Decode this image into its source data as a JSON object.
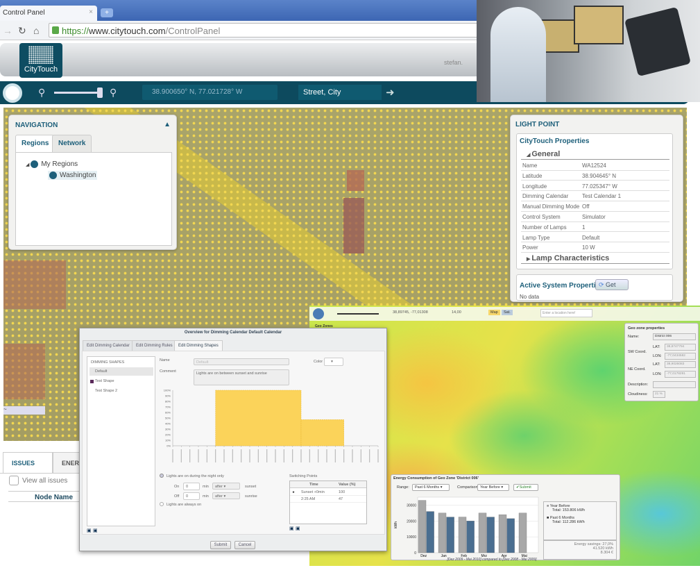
{
  "browser": {
    "tab_title": "Control Panel",
    "tab_close": "×",
    "new_tab": "+",
    "url_scheme": "https://",
    "url_host": "www.citytouch.com",
    "url_path": "/ControlPanel"
  },
  "header": {
    "logo_text": "CityTouch",
    "user": "stefan."
  },
  "toolbar": {
    "coordinates": "38.900650° N,  77.021728° W",
    "location": "Street, City"
  },
  "navigation": {
    "title": "NAVIGATION",
    "tabs": [
      "Regions",
      "Network"
    ],
    "tree": {
      "root": "My Regions",
      "child": "Washington"
    }
  },
  "light_point": {
    "title": "LIGHT POINT",
    "section": "CityTouch Properties",
    "group": "General",
    "properties": [
      [
        "Name",
        "WA12524"
      ],
      [
        "Latitude",
        "38.904645° N"
      ],
      [
        "Longitude",
        "77.025347° W"
      ],
      [
        "Dimming Calendar",
        "Test Calendar 1"
      ],
      [
        "Manual Dimming Mode",
        "Off"
      ],
      [
        "Control System",
        "Simulator"
      ],
      [
        "Number of Lamps",
        "1"
      ],
      [
        "Lamp Type",
        "Default"
      ],
      [
        "Power",
        "10 W"
      ]
    ],
    "lamp_characteristics": "Lamp Characteristics",
    "active_title": "Active System Properties",
    "get_button": "Get",
    "no_data": "No data"
  },
  "issues": {
    "tabs": [
      "ISSUES",
      "ENER"
    ],
    "view_all": "View all issues",
    "column": "Node Name"
  },
  "dimming_dialog": {
    "title": "Overview for Dimming Calendar Default Calendar",
    "tabs": [
      "Edit Dimming Calendar",
      "Edit Dimming Rules",
      "Edit Dimming Shapes"
    ],
    "shapes_header": "DIMMING SHAPES",
    "shapes": [
      "Default",
      "Test Shape",
      "Test Shape 2"
    ],
    "name_label": "Name",
    "name_value": "Default",
    "color_label": "Color",
    "comment_label": "Comment",
    "comment_value": "Lights are on between sunset and sunrise",
    "radio_night": "Lights are on during the night only",
    "radio_always": "Lights are always on",
    "on_label": "On",
    "off_label": "Off",
    "min": "min",
    "on_value": "0",
    "off_value": "0",
    "after": "after",
    "sunset": "sunset",
    "sunrise": "sunrise",
    "switching_title": "Switching Points",
    "switching_cols": [
      "Time",
      "Value (%)"
    ],
    "switching_rows": [
      [
        "Sunset +0min",
        "100"
      ],
      [
        "2:25 AM",
        "47"
      ]
    ],
    "submit": "Submit",
    "cancel": "Cancel"
  },
  "chart_data": [
    {
      "type": "area",
      "title": "",
      "ylabel": "",
      "ylim": [
        0,
        100
      ],
      "y_ticks": [
        "0%",
        "10%",
        "20%",
        "30%",
        "40%",
        "50%",
        "60%",
        "70%",
        "80%",
        "90%",
        "100%"
      ],
      "steps": [
        {
          "from": 0,
          "to": 5,
          "value": 0
        },
        {
          "from": 5,
          "to": 15,
          "value": 100
        },
        {
          "from": 15,
          "to": 20,
          "value": 47
        },
        {
          "from": 20,
          "to": 24,
          "value": 0
        }
      ],
      "x_range": [
        0,
        24
      ]
    },
    {
      "type": "bar",
      "title": "Energy Consumption of Geo Zone 'District 006'",
      "ylabel": "kWh",
      "ylim": [
        0,
        35000
      ],
      "y_ticks": [
        0,
        10000,
        20000,
        30000
      ],
      "categories": [
        "Dez",
        "Jan",
        "Feb",
        "Mrz",
        "Apr",
        "Mai"
      ],
      "series": [
        {
          "name": "Year Before",
          "color": "#a8a8a8",
          "values": [
            33000,
            25000,
            22500,
            25000,
            24000,
            25000
          ]
        },
        {
          "name": "Past 6 Months",
          "color": "#4a6e90",
          "values": [
            26000,
            22500,
            20000,
            22500,
            21500,
            null
          ]
        }
      ],
      "footer": "[Dez 2009 - Mai 2010] compared to [Dez 2008 - Mai 2009]"
    }
  ],
  "heatmap": {
    "coords": "38,89745, -77,01308",
    "zoom": "14,00",
    "map_btn": "Map",
    "sat_btn": "Sat.",
    "search_placeholder": "Enter a location here!",
    "geo_zones_title": "Geo Zones"
  },
  "geo_zone": {
    "title": "Geo zone properties",
    "name_label": "Name:",
    "name": "District 006",
    "sw": "SW Coord.",
    "ne": "NE Coord.",
    "lat": "LAT:",
    "lon": "LON:",
    "sw_lat": "38,8747794",
    "sw_lon": "-77,0434582",
    "ne_lat": "38,9026083",
    "ne_lon": "-77,0178291",
    "description": "Description:",
    "cloudiness": "Cloudiness:",
    "cloudiness_value": "21 %"
  },
  "energy": {
    "range_label": "Range:",
    "range": "Past 6 Months",
    "comparison_label": "Comparison:",
    "comparison": "Year Before",
    "submit": "✔Submit",
    "legend_year": "Year Before",
    "total_year": "Total: 153.806 kWh",
    "legend_past": "Past 6 Months",
    "total_past": "Total: 112.286 kWh",
    "savings": "Energy savings: 27,0%",
    "savings_kwh": "41.520 kWh",
    "savings_eur": "8.304 €"
  }
}
